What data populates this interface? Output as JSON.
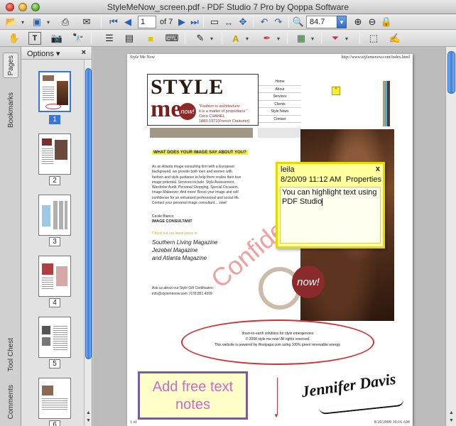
{
  "window": {
    "title": "StyleMeNow_screen.pdf - PDF Studio 7 Pro by Qoppa Software"
  },
  "toolbar": {
    "page_current": "1",
    "page_total": "of 7",
    "zoom": "84.7"
  },
  "side_tabs": [
    "Pages",
    "Bookmarks",
    "Tool Chest",
    "Comments"
  ],
  "thumbnails": {
    "options_label": "Options",
    "close_label": "×",
    "pages": [
      "1",
      "2",
      "3",
      "4",
      "5",
      "6"
    ],
    "selected": "1"
  },
  "page": {
    "header_left": "Style Me Now",
    "header_right": "http://www.stylemenow.com/index.html",
    "footer_left": "1 of",
    "footer_right": "8/20/2009 10:16 AM",
    "logo_style": "STYLE",
    "logo_me": "me",
    "logo_now": "now!",
    "logo_quote": "\"Fashion is architecture:\nit is a matter of proportions.\"\nCoco CHANEL\n1883-1971(French Couturier)",
    "nav": [
      "Home",
      "About",
      "Services",
      "Clients",
      "Style News",
      "Contact"
    ],
    "section_head": "WHAT DOES YOUR IMAGE SAY ABOUT YOU?",
    "body_copy": "As an Atlanta image consulting firm with a European background, we provide both men and women with fashion and style guidance to help them realize their true image potential. Services include: Style Assessment, Wardrobe Audit, Personal Shopping, Special Occasion, Image Makeover. And more! Boost your image and self confidence for an enhanced professional and social life. Contact your personal image consultant.....now!",
    "signer_name": "Cecile Blanco",
    "signer_title": "IMAGE CONSULTANT",
    "check_out": "Check out our latest press in:",
    "mags": [
      "Southern Living Magazine",
      "Jezebel Magazine",
      "and Atlanta Magazine"
    ],
    "ask": "Ask us about our Style Gift Certificates:",
    "ask_phone": "info@stylemenow.com | 678.851.4399",
    "now_badge": "now!",
    "stamp": "Confidential",
    "footer_lines": [
      "down-to-earth solutions for style emergencies",
      "© 2008 style me now! All rights reserved.",
      "This website is powered by Hostpapa.com using 100% green renewable energy."
    ],
    "freetext": "Add free text notes",
    "signature": "Jennifer Davis"
  },
  "note": {
    "author": "leila",
    "close": "x",
    "date": "8/20/09 11:12 AM",
    "properties": "Properties",
    "body": "You can highlight text using PDF Studio"
  },
  "icons": [
    "open-icon",
    "save-icon",
    "print-icon",
    "email-icon",
    "first-page-icon",
    "prev-page-icon",
    "next-page-icon",
    "last-page-icon",
    "fit-width-icon",
    "fit-page-icon",
    "undo-icon",
    "redo-icon",
    "zoom-icon",
    "hand-icon",
    "text-select-icon",
    "snapshot-icon",
    "find-icon",
    "layout-icon",
    "note-icon",
    "sticky-icon",
    "typewriter-icon",
    "pen-icon",
    "highlight-icon",
    "stamp-icon",
    "shape-icon",
    "link-icon",
    "sign-icon"
  ],
  "colors": {
    "accent": "#3875d7",
    "note_bg": "#ffff9e",
    "annotation_red": "#d23232",
    "freetext_text": "#d068c8"
  }
}
